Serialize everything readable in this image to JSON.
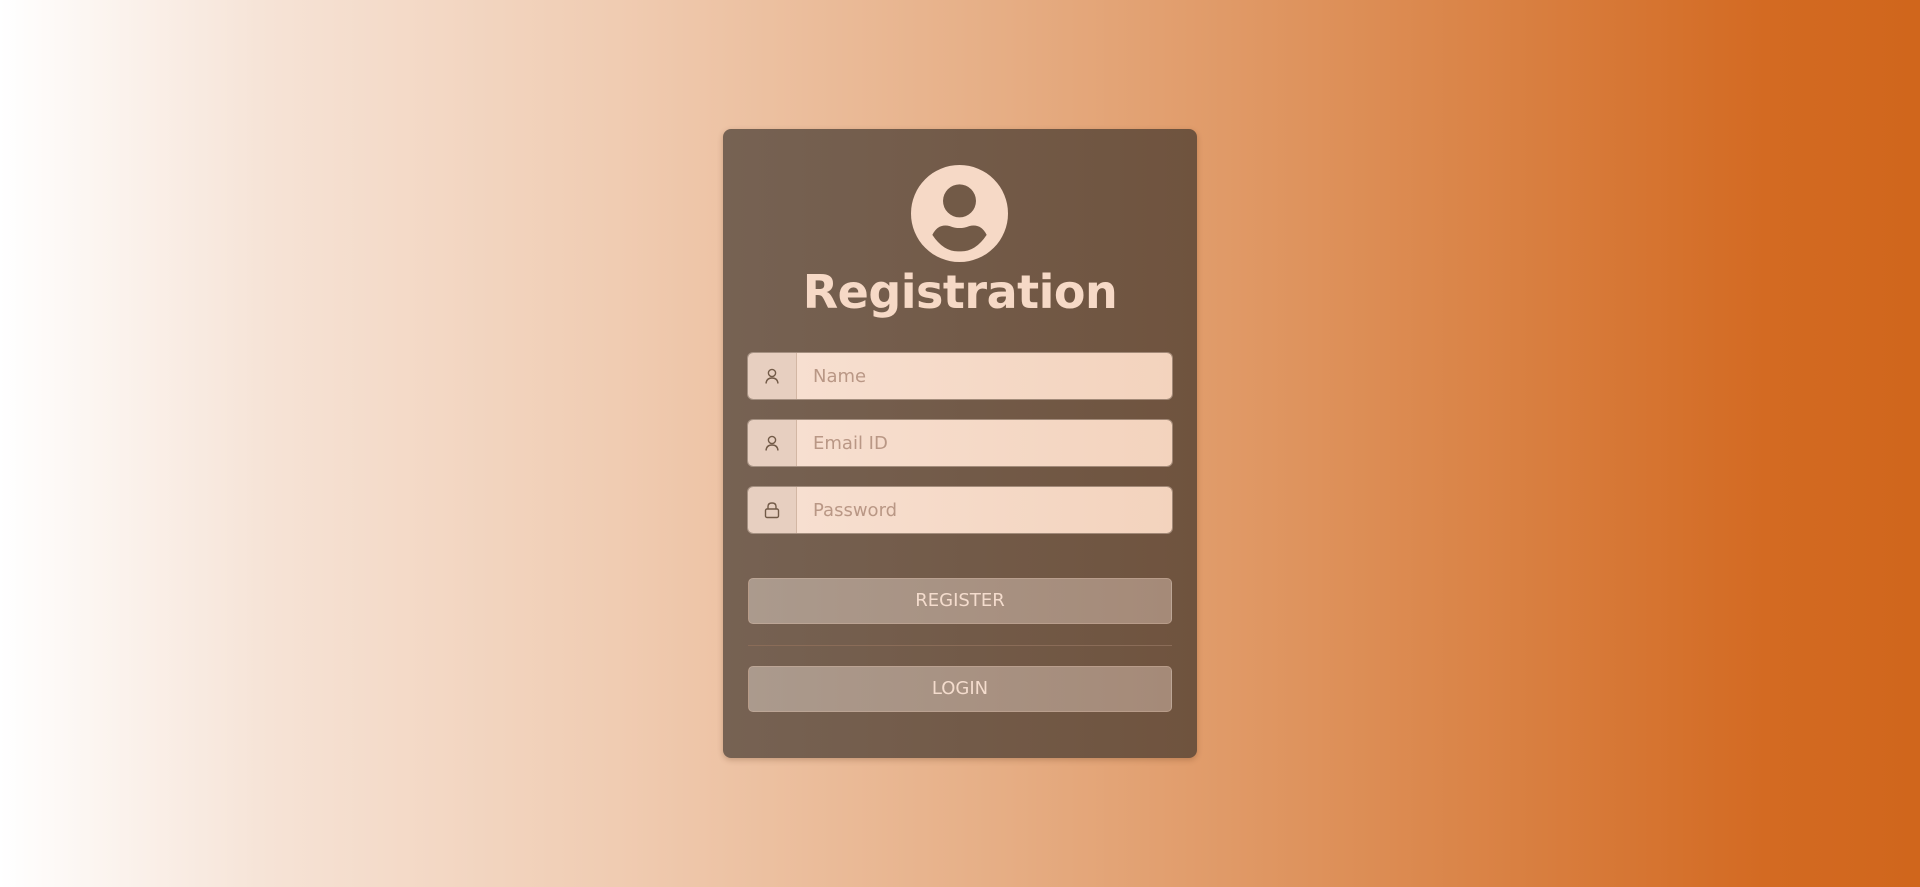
{
  "form": {
    "title": "Registration",
    "avatar_icon": "user-circle-icon",
    "fields": [
      {
        "icon": "user-icon",
        "placeholder": "Name",
        "value": ""
      },
      {
        "icon": "user-icon",
        "placeholder": "Email ID",
        "value": ""
      },
      {
        "icon": "lock-icon",
        "placeholder": "Password",
        "value": ""
      }
    ],
    "register_label": "REGISTER",
    "login_label": "LOGIN"
  },
  "colors": {
    "background_start": "#ffffff",
    "background_end": "#d0661c",
    "card": "#725a47",
    "title_text": "#f6d9c6",
    "input_bg": "#f5dacb",
    "button_bg": "#a8917f"
  }
}
